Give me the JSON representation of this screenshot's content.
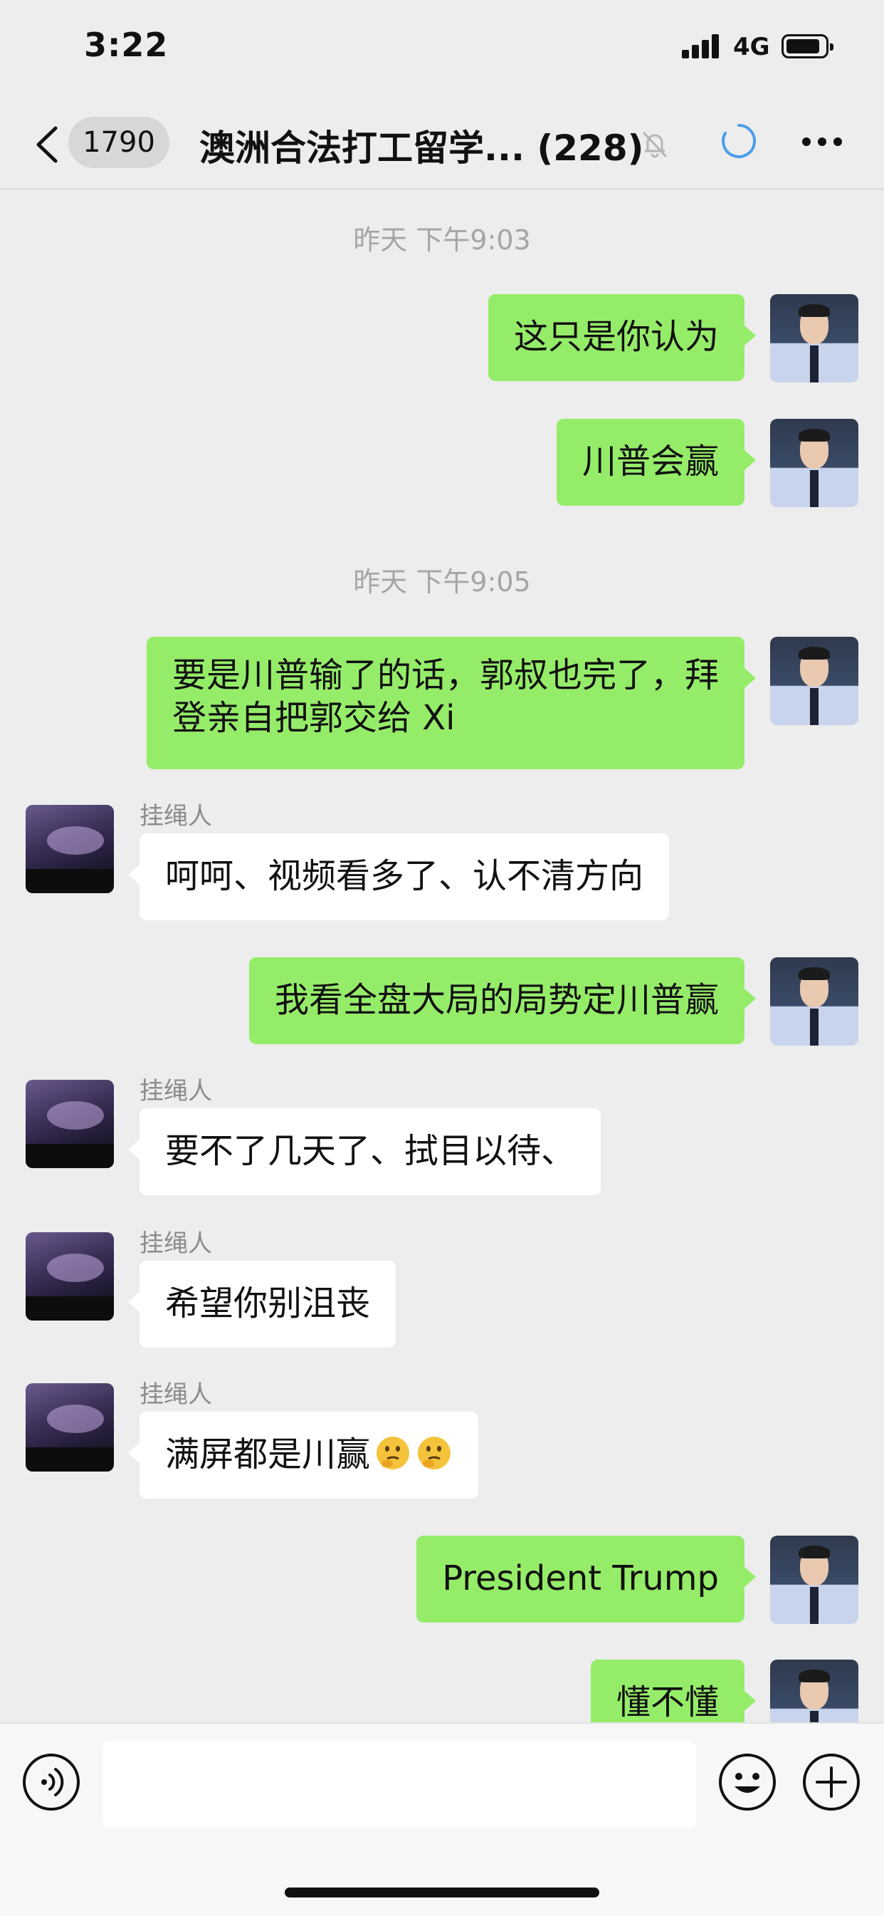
{
  "status_bar": {
    "time": "3:22",
    "network": "4G"
  },
  "header": {
    "unread_count": "1790",
    "title": "澳洲合法打工留学... (228)"
  },
  "messages": [
    {
      "type": "time",
      "text": "昨天 下午9:03"
    },
    {
      "type": "me",
      "text": "这只是你认为"
    },
    {
      "type": "me",
      "text": "川普会赢"
    },
    {
      "type": "time",
      "text": "昨天 下午9:05"
    },
    {
      "type": "me",
      "text": "要是川普输了的话，郭叔也完了，拜登亲自把郭交给 Xi"
    },
    {
      "type": "other",
      "sender": "挂绳人",
      "text": "呵呵、视频看多了、认不清方向"
    },
    {
      "type": "me",
      "text": "我看全盘大局的局势定川普赢"
    },
    {
      "type": "other",
      "sender": "挂绳人",
      "text": "要不了几天了、拭目以待、"
    },
    {
      "type": "other",
      "sender": "挂绳人",
      "text": "希望你别沮丧"
    },
    {
      "type": "other",
      "sender": "挂绳人",
      "text": "满屏都是川赢",
      "emoji": "thinking-face x2"
    },
    {
      "type": "me",
      "text": "President Trump"
    },
    {
      "type": "me",
      "text": "懂不懂"
    }
  ],
  "colors": {
    "background": "#ededed",
    "my_bubble": "#95ec69",
    "other_bubble": "#ffffff",
    "sync_icon": "#4a9eea"
  }
}
